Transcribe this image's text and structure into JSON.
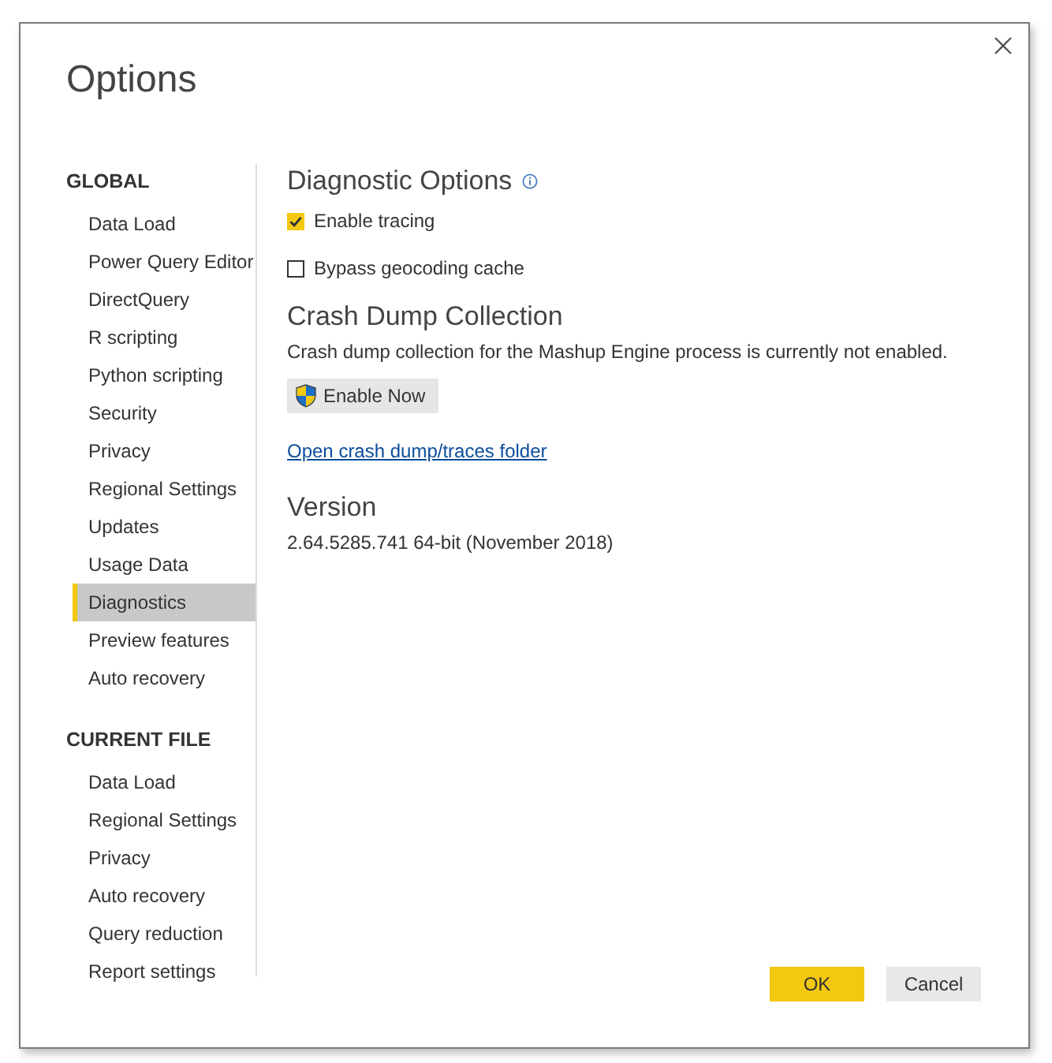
{
  "window": {
    "title": "Options"
  },
  "sidebar": {
    "sections": [
      {
        "heading": "GLOBAL",
        "items": [
          {
            "label": "Data Load",
            "selected": false
          },
          {
            "label": "Power Query Editor",
            "selected": false
          },
          {
            "label": "DirectQuery",
            "selected": false
          },
          {
            "label": "R scripting",
            "selected": false
          },
          {
            "label": "Python scripting",
            "selected": false
          },
          {
            "label": "Security",
            "selected": false
          },
          {
            "label": "Privacy",
            "selected": false
          },
          {
            "label": "Regional Settings",
            "selected": false
          },
          {
            "label": "Updates",
            "selected": false
          },
          {
            "label": "Usage Data",
            "selected": false
          },
          {
            "label": "Diagnostics",
            "selected": true
          },
          {
            "label": "Preview features",
            "selected": false
          },
          {
            "label": "Auto recovery",
            "selected": false
          }
        ]
      },
      {
        "heading": "CURRENT FILE",
        "items": [
          {
            "label": "Data Load",
            "selected": false
          },
          {
            "label": "Regional Settings",
            "selected": false
          },
          {
            "label": "Privacy",
            "selected": false
          },
          {
            "label": "Auto recovery",
            "selected": false
          },
          {
            "label": "Query reduction",
            "selected": false
          },
          {
            "label": "Report settings",
            "selected": false
          }
        ]
      }
    ]
  },
  "content": [
    {
      "kind": "heading",
      "text": "Diagnostic Options",
      "info": true
    },
    {
      "kind": "checkbox",
      "label": "Enable tracing",
      "checked": true
    },
    {
      "kind": "checkbox",
      "label": "Bypass geocoding cache",
      "checked": false
    },
    {
      "kind": "heading",
      "text": "Crash Dump Collection",
      "info": false
    },
    {
      "kind": "text",
      "text": "Crash dump collection for the Mashup Engine process is currently not enabled."
    },
    {
      "kind": "button",
      "label": "Enable Now"
    },
    {
      "kind": "link",
      "text": "Open crash dump/traces folder"
    },
    {
      "kind": "heading",
      "text": "Version",
      "info": false
    },
    {
      "kind": "text",
      "text": "2.64.5285.741 64-bit (November 2018)"
    }
  ],
  "buttons": [
    {
      "label": "OK",
      "primary": true
    },
    {
      "label": "Cancel",
      "primary": false
    }
  ]
}
